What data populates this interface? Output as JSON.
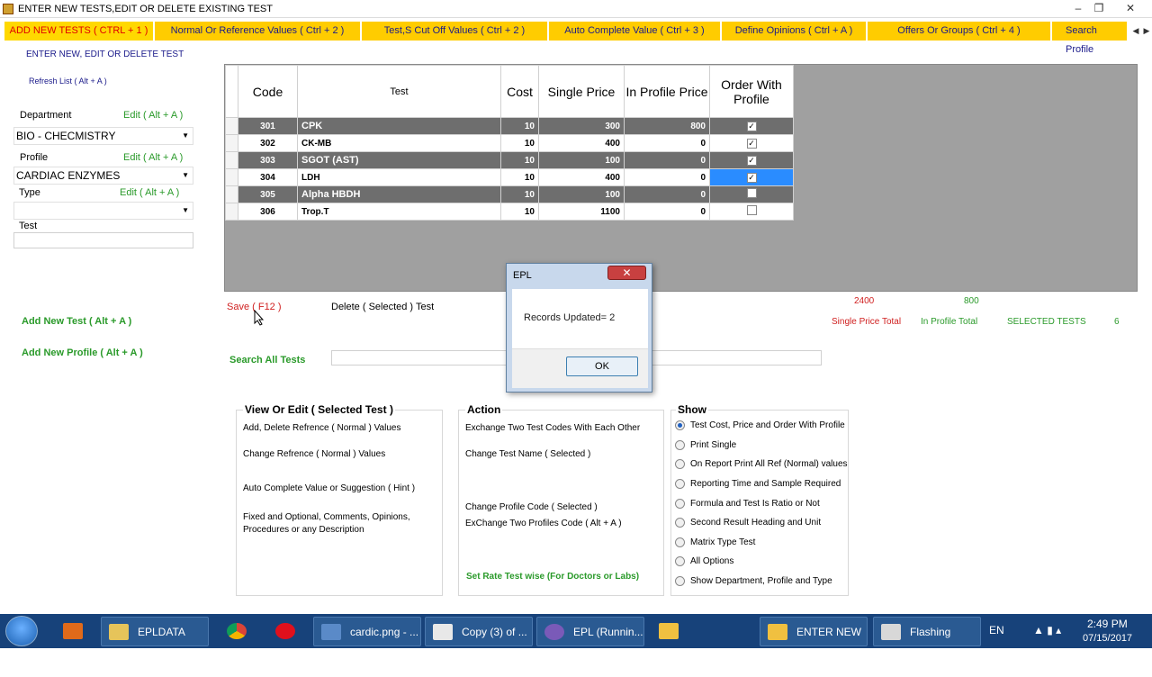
{
  "window": {
    "title": "ENTER NEW TESTS,EDIT OR DELETE EXISTING TEST"
  },
  "tabs": [
    {
      "label": "ADD NEW TESTS   ( CTRL + 1 )"
    },
    {
      "label": "Normal Or Reference Values  ( Ctrl + 2 )"
    },
    {
      "label": "Test,S Cut Off Values    ( Ctrl + 2 )"
    },
    {
      "label": "Auto Complete Value  ( Ctrl + 3 )"
    },
    {
      "label": "Define Opinions  ( Ctrl + A )"
    },
    {
      "label": "Offers Or Groups    ( Ctrl + 4 )"
    },
    {
      "label": "Search Profile"
    }
  ],
  "left": {
    "heading": "ENTER NEW, EDIT OR DELETE TEST",
    "refresh": "Refresh  List ( Alt + A )",
    "department_label": "Department",
    "department_edit": "Edit  ( Alt + A )",
    "department_value": "BIO -  CHECMISTRY",
    "profile_label": "Profile",
    "profile_edit": "Edit  ( Alt + A )",
    "profile_value": "CARDIAC ENZYMES",
    "type_label": "Type",
    "type_edit": "Edit  ( Alt + A )",
    "type_value": "",
    "test_label": "Test",
    "test_value": "",
    "add_test": "Add New Test  ( Alt + A )",
    "add_profile": "Add New Profile  ( Alt + A )"
  },
  "grid": {
    "headers": {
      "code": "Code",
      "test": "Test",
      "cost": "Cost",
      "single": "Single Price",
      "inprofile": "In Profile Price",
      "order": "Order With Profile"
    },
    "rows": [
      {
        "code": "301",
        "test": "CPK",
        "cost": "10",
        "single": "300",
        "inprofile": "800",
        "order": true
      },
      {
        "code": "302",
        "test": "CK-MB",
        "cost": "10",
        "single": "400",
        "inprofile": "0",
        "order": true
      },
      {
        "code": "303",
        "test": "SGOT (AST)",
        "cost": "10",
        "single": "100",
        "inprofile": "0",
        "order": true
      },
      {
        "code": "304",
        "test": "LDH",
        "cost": "10",
        "single": "400",
        "inprofile": "0",
        "order": true
      },
      {
        "code": "305",
        "test": "Alpha HBDH",
        "cost": "10",
        "single": "100",
        "inprofile": "0",
        "order": false
      },
      {
        "code": "306",
        "test": "Trop.T",
        "cost": "10",
        "single": "1100",
        "inprofile": "0",
        "order": false
      }
    ]
  },
  "actions": {
    "save": "Save  ( F12 )",
    "delete": "Delete ( Selected ) Test",
    "search_label": "Search All Tests",
    "search_value": ""
  },
  "totals": {
    "single_total_value": "2400",
    "in_profile_total_value": "800",
    "single_total_label": "Single Price Total",
    "in_profile_total_label": "In Profile Total",
    "selected_label": "SELECTED TESTS",
    "selected_value": "6"
  },
  "view_edit": {
    "title": "View Or Edit ( Selected Test )",
    "items": [
      "Add, Delete Refrence ( Normal  ) Values",
      "Change Refrence ( Normal  ) Values",
      "Auto Complete Value or Suggestion ( Hint )",
      "Fixed and Optional, Comments, Opinions, Procedures or any Description"
    ]
  },
  "action_box": {
    "title": "Action",
    "items": [
      "Exchange Two Test Codes With Each Other",
      "Change Test Name ( Selected )",
      "Change Profile Code ( Selected )",
      "ExChange  Two Profiles Code (  Alt + A )"
    ],
    "rate_link": "Set Rate Test wise (For Doctors or Labs)"
  },
  "show": {
    "title": "Show",
    "options": [
      {
        "label": "Test Cost, Price  and Order With Profile",
        "selected": true
      },
      {
        "label": "Print Single",
        "selected": false
      },
      {
        "label": "On Report Print All Ref (Normal) values",
        "selected": false
      },
      {
        "label": "Reporting Time and Sample Required",
        "selected": false
      },
      {
        "label": "Formula and Test Is Ratio or Not",
        "selected": false
      },
      {
        "label": "Second Result Heading and Unit",
        "selected": false
      },
      {
        "label": "Matrix Type Test",
        "selected": false
      },
      {
        "label": "All Options",
        "selected": false
      },
      {
        "label": "Show Department, Profile and Type",
        "selected": false
      }
    ]
  },
  "dialog": {
    "title": "EPL",
    "message": "Records Updated= 2",
    "ok": "OK",
    "close": "✕"
  },
  "taskbar": {
    "items": [
      {
        "label": "EPLDATA"
      },
      {
        "label": "cardic.png - ..."
      },
      {
        "label": "Copy (3) of ..."
      },
      {
        "label": "EPL (Runnin..."
      },
      {
        "label": "ENTER NEW ..."
      },
      {
        "label": "Flashing"
      }
    ],
    "lang": "EN",
    "time": "2:49 PM",
    "date": "07/15/2017"
  }
}
